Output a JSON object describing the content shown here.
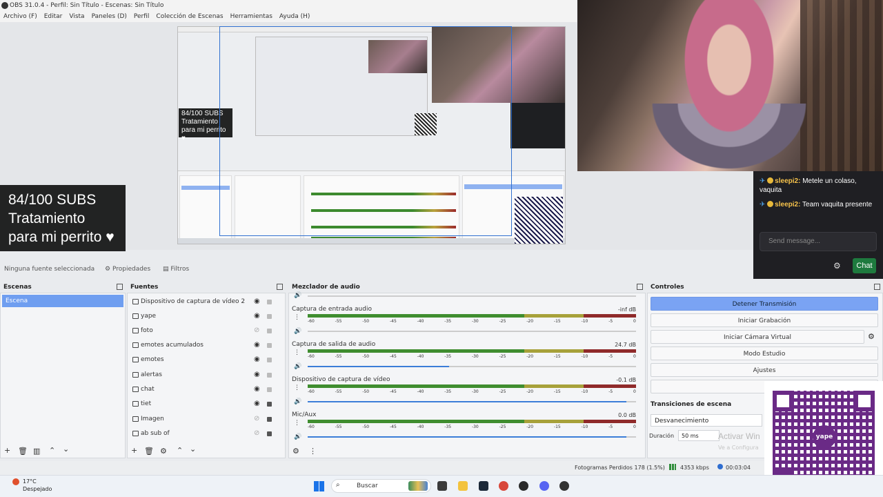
{
  "window": {
    "title": "OBS 31.0.4 - Perfil: Sin Título - Escenas: Sin Título"
  },
  "menu": [
    "Archivo (F)",
    "Editar",
    "Vista",
    "Paneles (D)",
    "Perfil",
    "Colección de Escenas",
    "Herramientas",
    "Ayuda (H)"
  ],
  "overlay": {
    "subs_line1": "84/100 SUBS",
    "subs_line2": "Tratamiento",
    "subs_line3": "para mi perrito ♥"
  },
  "chat": {
    "messages": [
      {
        "user": "sleepi2:",
        "text": "Metele un colaso, vaquita"
      },
      {
        "user": "sleepi2:",
        "text": "Team vaquita presente"
      }
    ],
    "input_placeholder": "Send message...",
    "send_label": "Chat"
  },
  "source_bar": {
    "none_selected": "Ninguna fuente seleccionada",
    "properties": "Propiedades",
    "filters": "Filtros"
  },
  "scenes": {
    "header": "Escenas",
    "items": [
      "Escena"
    ]
  },
  "sources": {
    "header": "Fuentes",
    "items": [
      {
        "name": "Dispositivo de captura de vídeo 2",
        "visible": true,
        "locked": false
      },
      {
        "name": "yape",
        "visible": true,
        "locked": false
      },
      {
        "name": "foto",
        "visible": false,
        "locked": false
      },
      {
        "name": "emotes acumulados",
        "visible": true,
        "locked": false
      },
      {
        "name": "emotes",
        "visible": true,
        "locked": false
      },
      {
        "name": "alertas",
        "visible": true,
        "locked": false
      },
      {
        "name": "chat",
        "visible": true,
        "locked": false
      },
      {
        "name": "tiet",
        "visible": true,
        "locked": true
      },
      {
        "name": "Imagen",
        "visible": false,
        "locked": true
      },
      {
        "name": "ab sub of",
        "visible": false,
        "locked": true
      }
    ]
  },
  "mixer": {
    "header": "Mezclador de audio",
    "channels": [
      {
        "name": "Captura de entrada audio",
        "db": "-inf dB"
      },
      {
        "name": "Captura de salida de audio",
        "db": "24.7 dB"
      },
      {
        "name": "Dispositivo de captura de vídeo",
        "db": "-0.1 dB"
      },
      {
        "name": "Mic/Aux",
        "db": "0.0 dB"
      }
    ],
    "scale": [
      "-60",
      "-55",
      "-50",
      "-45",
      "-40",
      "-35",
      "-30",
      "-25",
      "-20",
      "-15",
      "-10",
      "-5",
      "0"
    ]
  },
  "controls": {
    "header": "Controles",
    "buttons": [
      "Detener Transmisión",
      "Iniciar Grabación",
      "Iniciar Cámara Virtual",
      "Modo Estudio",
      "Ajustes"
    ]
  },
  "transitions": {
    "header": "Transiciones de escena",
    "selected": "Desvanecimiento",
    "duration_label": "Duración",
    "duration_value": "50 ms"
  },
  "watermark": {
    "line1": "Activar Win",
    "line2": "Ve a Configura"
  },
  "qr": {
    "logo": "yape"
  },
  "status": {
    "dropped": "Fotogramas Perdidos 178 (1.5%)",
    "bitrate": "4353 kbps",
    "time": "00:03:04"
  },
  "taskbar": {
    "weather_temp": "17°C",
    "weather_desc": "Despejado",
    "search": "Buscar"
  },
  "colors": {
    "accent": "#6f9ef0",
    "chat_bg": "#1f1f23",
    "chat_user": "#f7c34b",
    "qr": "#6a2a86"
  }
}
